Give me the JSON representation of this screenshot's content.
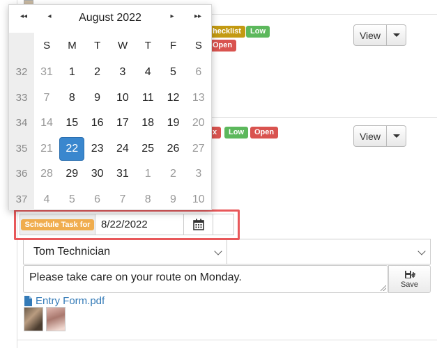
{
  "calendar": {
    "title": "August 2022",
    "nav": {
      "prev_year": "◂◂",
      "prev_month": "◂",
      "next_month": "▸",
      "next_year": "▸▸"
    },
    "weekdays": [
      "S",
      "M",
      "T",
      "W",
      "T",
      "F",
      "S"
    ],
    "weeks": [
      {
        "week": "32",
        "days": [
          "31",
          "1",
          "2",
          "3",
          "4",
          "5",
          "6"
        ]
      },
      {
        "week": "33",
        "days": [
          "7",
          "8",
          "9",
          "10",
          "11",
          "12",
          "13"
        ]
      },
      {
        "week": "34",
        "days": [
          "14",
          "15",
          "16",
          "17",
          "18",
          "19",
          "20"
        ]
      },
      {
        "week": "35",
        "days": [
          "21",
          "22",
          "23",
          "24",
          "25",
          "26",
          "27"
        ]
      },
      {
        "week": "36",
        "days": [
          "28",
          "29",
          "30",
          "31",
          "1",
          "2",
          "3"
        ]
      },
      {
        "week": "37",
        "days": [
          "4",
          "5",
          "6",
          "7",
          "8",
          "9",
          "10"
        ]
      }
    ],
    "selected": "22"
  },
  "tasks": [
    {
      "badges": [
        "hecklist",
        "Low",
        "Open"
      ],
      "view_label": "View"
    },
    {
      "badges": [
        "x",
        "Low",
        "Open"
      ],
      "view_label": "View"
    }
  ],
  "schedule": {
    "label": "Schedule Task for",
    "date_value": "8/22/2022",
    "calendar_icon": "calendar-icon"
  },
  "assignee": {
    "selected": "Tom Technician",
    "second_selected": ""
  },
  "note": {
    "value": "Please take care on your route on Monday."
  },
  "save_label": "Save",
  "attachment": {
    "name": "Entry Form.pdf",
    "icon": "file-icon"
  },
  "colors": {
    "accent": "#3a87ce",
    "highlight_border": "#e8585a",
    "warning": "#f0ad4e",
    "success": "#5cb85c",
    "danger": "#d9534f"
  }
}
